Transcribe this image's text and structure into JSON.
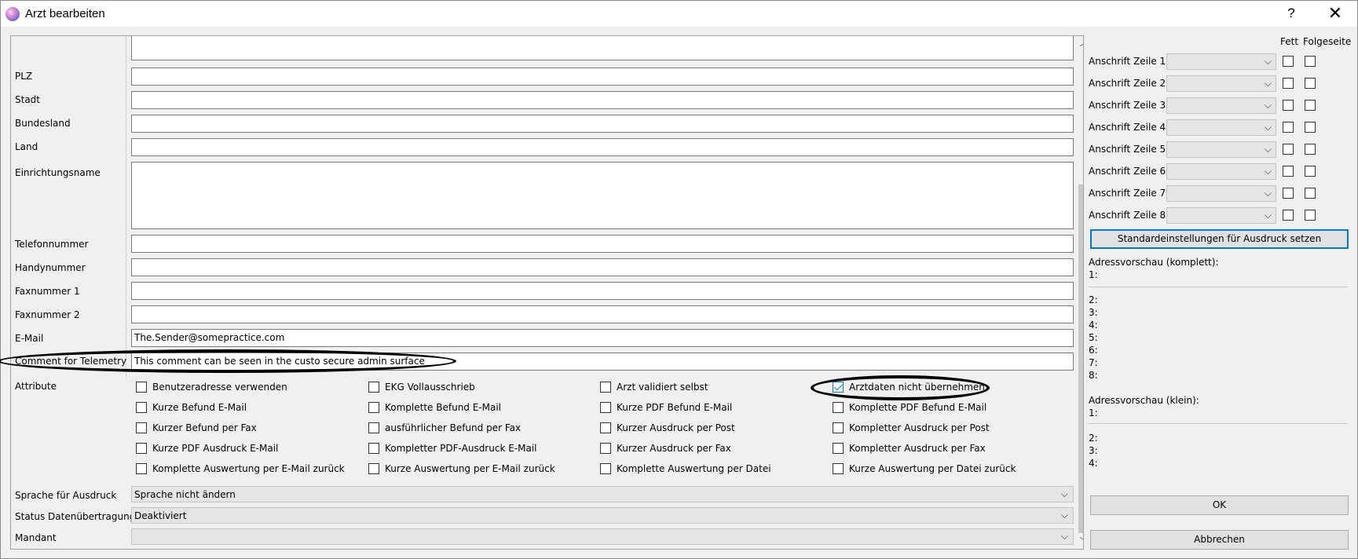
{
  "window": {
    "title": "Arzt bearbeiten",
    "help_label": "?",
    "close_label": "✕"
  },
  "form": {
    "fields": [
      {
        "label": "",
        "value": ""
      },
      {
        "label": "PLZ",
        "value": ""
      },
      {
        "label": "Stadt",
        "value": ""
      },
      {
        "label": "Bundesland",
        "value": ""
      },
      {
        "label": "Land",
        "value": ""
      },
      {
        "label": "Einrichtungsname",
        "value": ""
      },
      {
        "label": "Telefonnummer",
        "value": ""
      },
      {
        "label": "Handynummer",
        "value": ""
      },
      {
        "label": "Faxnummer 1",
        "value": ""
      },
      {
        "label": "Faxnummer 2",
        "value": ""
      },
      {
        "label": "E-Mail",
        "value": "The.Sender@somepractice.com"
      },
      {
        "label": "Comment for Telemetry",
        "value": "This comment can be seen in the custo secure admin surface"
      }
    ],
    "attribute_label": "Attribute",
    "attributes": [
      {
        "label": "Benutzeradresse verwenden",
        "checked": false
      },
      {
        "label": "EKG Vollausschrieb",
        "checked": false
      },
      {
        "label": "Arzt validiert selbst",
        "checked": false
      },
      {
        "label": "Arztdaten nicht übernehmen",
        "checked": true
      },
      {
        "label": "Kurze Befund E-Mail",
        "checked": false
      },
      {
        "label": "Komplette Befund E-Mail",
        "checked": false
      },
      {
        "label": "Kurze PDF Befund E-Mail",
        "checked": false
      },
      {
        "label": "Komplette PDF Befund E-Mail",
        "checked": false
      },
      {
        "label": "Kurzer Befund per Fax",
        "checked": false
      },
      {
        "label": "ausführlicher Befund per Fax",
        "checked": false
      },
      {
        "label": "Kurzer Ausdruck per Post",
        "checked": false
      },
      {
        "label": "Kompletter Ausdruck per Post",
        "checked": false
      },
      {
        "label": "Kurze PDF Ausdruck E-Mail",
        "checked": false
      },
      {
        "label": "Kompletter PDF-Ausdruck E-Mail",
        "checked": false
      },
      {
        "label": "Kurzer Ausdruck per Fax",
        "checked": false
      },
      {
        "label": "Kompletter Ausdruck per Fax",
        "checked": false
      },
      {
        "label": "Komplette Auswertung per E-Mail zurück",
        "checked": false
      },
      {
        "label": "Kurze Auswertung per E-Mail zurück",
        "checked": false
      },
      {
        "label": "Komplette Auswertung per Datei",
        "checked": false
      },
      {
        "label": "Kurze Auswertung per Datei zurück",
        "checked": false
      }
    ],
    "selects": [
      {
        "label": "Sprache für Ausdruck",
        "value": "Sprache nicht ändern"
      },
      {
        "label": "Status Datenübertragung",
        "value": "Deaktiviert"
      },
      {
        "label": "Mandant",
        "value": ""
      }
    ]
  },
  "print_settings": {
    "col_bold": "Fett",
    "col_next_page": "Folgeseite",
    "rows": [
      {
        "label": "Anschrift Zeile 1"
      },
      {
        "label": "Anschrift Zeile 2"
      },
      {
        "label": "Anschrift Zeile 3"
      },
      {
        "label": "Anschrift Zeile 4"
      },
      {
        "label": "Anschrift Zeile 5"
      },
      {
        "label": "Anschrift Zeile 6"
      },
      {
        "label": "Anschrift Zeile 7"
      },
      {
        "label": "Anschrift Zeile 8"
      }
    ],
    "default_button": "Standardeinstellungen für Ausdruck setzen",
    "preview_full_title": "Adressvorschau (komplett):",
    "preview_full_lines": [
      "1:",
      "2:",
      "3:",
      "4:",
      "5:",
      "6:",
      "7:",
      "8:"
    ],
    "preview_small_title": "Adressvorschau (klein):",
    "preview_small_lines": [
      "1:",
      "2:",
      "3:",
      "4:"
    ]
  },
  "buttons": {
    "ok": "OK",
    "cancel": "Abbrechen"
  },
  "icons": {
    "app": "app-logo-icon",
    "dropdown": "chevron-down-icon",
    "scroll_up": "chevron-up-icon"
  }
}
